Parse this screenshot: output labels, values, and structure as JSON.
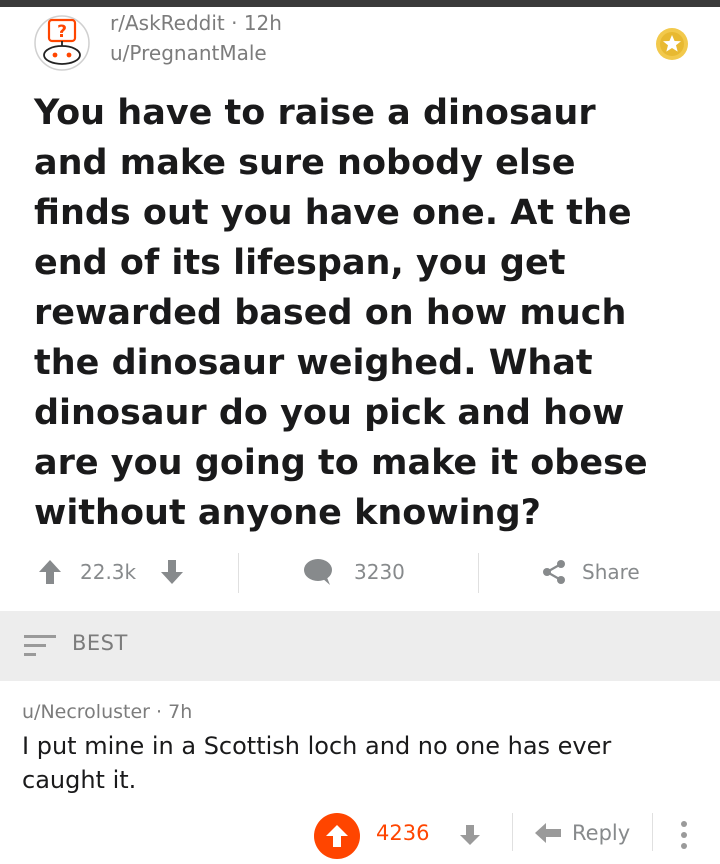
{
  "post": {
    "subreddit": "r/AskReddit",
    "separator": "·",
    "time": "12h",
    "author": "u/PregnantMale",
    "title": "You have to raise a dinosaur and make sure nobody else finds out you have one. At the end of its lifespan, you get rewarded based on how much the dinosaur weighed. What dinosaur do you pick and how are you going to make it obese without anyone knowing?",
    "score": "22.3k",
    "comments": "3230",
    "share_label": "Share"
  },
  "sort": {
    "label": "BEST"
  },
  "comment": {
    "author": "u/Necroluster",
    "separator": "·",
    "time": "7h",
    "body": "I put mine in a Scottish loch and no one has ever caught it.",
    "score": "4236",
    "reply_label": "Reply"
  },
  "colors": {
    "upvote_active": "#ff4500",
    "award_gold": "#f2c94c",
    "meta_gray": "#7c7c7c",
    "sort_bar_bg": "#ededed"
  },
  "icons": {
    "subreddit": "askreddit-snoo-icon",
    "award": "gold-award-icon",
    "upvote": "arrow-up-icon",
    "downvote": "arrow-down-icon",
    "comments": "speech-bubble-icon",
    "share": "share-icon",
    "sort": "sort-lines-icon",
    "reply": "reply-arrow-icon",
    "more": "vertical-dots-icon"
  }
}
